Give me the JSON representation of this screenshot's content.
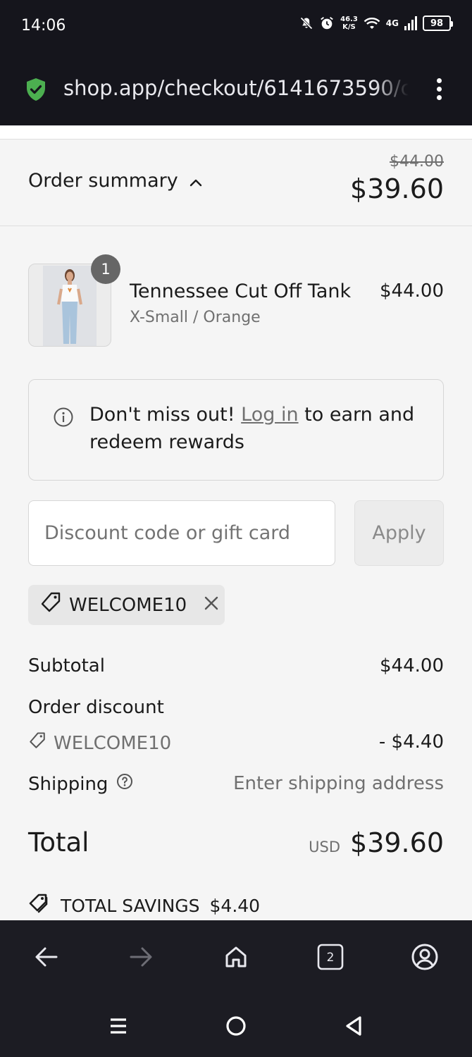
{
  "status_bar": {
    "time": "14:06",
    "speed_value": "46.3",
    "speed_unit": "K/S",
    "network": "4G",
    "battery": "98"
  },
  "browser": {
    "url": "shop.app/checkout/6141673590/c"
  },
  "order_summary": {
    "toggle_label": "Order summary",
    "original_price": "$44.00",
    "discounted_price": "$39.60"
  },
  "line_item": {
    "quantity": "1",
    "name": "Tennessee Cut Off Tank",
    "variant": "X-Small / Orange",
    "price": "$44.00"
  },
  "rewards": {
    "prefix": "Don't miss out! ",
    "link": "Log in",
    "suffix": " to earn and redeem rewards"
  },
  "discount": {
    "placeholder": "Discount code or gift card",
    "apply_label": "Apply",
    "applied_code": "WELCOME10"
  },
  "totals": {
    "subtotal_label": "Subtotal",
    "subtotal_value": "$44.00",
    "order_discount_label": "Order discount",
    "discount_code": "WELCOME10",
    "discount_value": "- $4.40",
    "shipping_label": "Shipping",
    "shipping_value": "Enter shipping address",
    "total_label": "Total",
    "currency": "USD",
    "total_value": "$39.60",
    "savings_label": "TOTAL SAVINGS",
    "savings_value": "$4.40"
  },
  "nav": {
    "tab_count": "2"
  },
  "colors": {
    "shield": "#4caf50",
    "page_background": "#f5f5f5",
    "chrome_background": "#15151c"
  }
}
